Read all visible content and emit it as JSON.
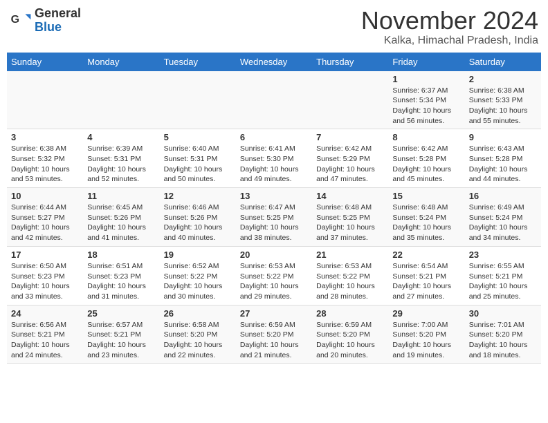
{
  "header": {
    "logo_general": "General",
    "logo_blue": "Blue",
    "month_title": "November 2024",
    "location": "Kalka, Himachal Pradesh, India"
  },
  "calendar": {
    "days_of_week": [
      "Sunday",
      "Monday",
      "Tuesday",
      "Wednesday",
      "Thursday",
      "Friday",
      "Saturday"
    ],
    "weeks": [
      [
        {
          "day": "",
          "detail": ""
        },
        {
          "day": "",
          "detail": ""
        },
        {
          "day": "",
          "detail": ""
        },
        {
          "day": "",
          "detail": ""
        },
        {
          "day": "",
          "detail": ""
        },
        {
          "day": "1",
          "detail": "Sunrise: 6:37 AM\nSunset: 5:34 PM\nDaylight: 10 hours and 56 minutes."
        },
        {
          "day": "2",
          "detail": "Sunrise: 6:38 AM\nSunset: 5:33 PM\nDaylight: 10 hours and 55 minutes."
        }
      ],
      [
        {
          "day": "3",
          "detail": "Sunrise: 6:38 AM\nSunset: 5:32 PM\nDaylight: 10 hours and 53 minutes."
        },
        {
          "day": "4",
          "detail": "Sunrise: 6:39 AM\nSunset: 5:31 PM\nDaylight: 10 hours and 52 minutes."
        },
        {
          "day": "5",
          "detail": "Sunrise: 6:40 AM\nSunset: 5:31 PM\nDaylight: 10 hours and 50 minutes."
        },
        {
          "day": "6",
          "detail": "Sunrise: 6:41 AM\nSunset: 5:30 PM\nDaylight: 10 hours and 49 minutes."
        },
        {
          "day": "7",
          "detail": "Sunrise: 6:42 AM\nSunset: 5:29 PM\nDaylight: 10 hours and 47 minutes."
        },
        {
          "day": "8",
          "detail": "Sunrise: 6:42 AM\nSunset: 5:28 PM\nDaylight: 10 hours and 45 minutes."
        },
        {
          "day": "9",
          "detail": "Sunrise: 6:43 AM\nSunset: 5:28 PM\nDaylight: 10 hours and 44 minutes."
        }
      ],
      [
        {
          "day": "10",
          "detail": "Sunrise: 6:44 AM\nSunset: 5:27 PM\nDaylight: 10 hours and 42 minutes."
        },
        {
          "day": "11",
          "detail": "Sunrise: 6:45 AM\nSunset: 5:26 PM\nDaylight: 10 hours and 41 minutes."
        },
        {
          "day": "12",
          "detail": "Sunrise: 6:46 AM\nSunset: 5:26 PM\nDaylight: 10 hours and 40 minutes."
        },
        {
          "day": "13",
          "detail": "Sunrise: 6:47 AM\nSunset: 5:25 PM\nDaylight: 10 hours and 38 minutes."
        },
        {
          "day": "14",
          "detail": "Sunrise: 6:48 AM\nSunset: 5:25 PM\nDaylight: 10 hours and 37 minutes."
        },
        {
          "day": "15",
          "detail": "Sunrise: 6:48 AM\nSunset: 5:24 PM\nDaylight: 10 hours and 35 minutes."
        },
        {
          "day": "16",
          "detail": "Sunrise: 6:49 AM\nSunset: 5:24 PM\nDaylight: 10 hours and 34 minutes."
        }
      ],
      [
        {
          "day": "17",
          "detail": "Sunrise: 6:50 AM\nSunset: 5:23 PM\nDaylight: 10 hours and 33 minutes."
        },
        {
          "day": "18",
          "detail": "Sunrise: 6:51 AM\nSunset: 5:23 PM\nDaylight: 10 hours and 31 minutes."
        },
        {
          "day": "19",
          "detail": "Sunrise: 6:52 AM\nSunset: 5:22 PM\nDaylight: 10 hours and 30 minutes."
        },
        {
          "day": "20",
          "detail": "Sunrise: 6:53 AM\nSunset: 5:22 PM\nDaylight: 10 hours and 29 minutes."
        },
        {
          "day": "21",
          "detail": "Sunrise: 6:53 AM\nSunset: 5:22 PM\nDaylight: 10 hours and 28 minutes."
        },
        {
          "day": "22",
          "detail": "Sunrise: 6:54 AM\nSunset: 5:21 PM\nDaylight: 10 hours and 27 minutes."
        },
        {
          "day": "23",
          "detail": "Sunrise: 6:55 AM\nSunset: 5:21 PM\nDaylight: 10 hours and 25 minutes."
        }
      ],
      [
        {
          "day": "24",
          "detail": "Sunrise: 6:56 AM\nSunset: 5:21 PM\nDaylight: 10 hours and 24 minutes."
        },
        {
          "day": "25",
          "detail": "Sunrise: 6:57 AM\nSunset: 5:21 PM\nDaylight: 10 hours and 23 minutes."
        },
        {
          "day": "26",
          "detail": "Sunrise: 6:58 AM\nSunset: 5:20 PM\nDaylight: 10 hours and 22 minutes."
        },
        {
          "day": "27",
          "detail": "Sunrise: 6:59 AM\nSunset: 5:20 PM\nDaylight: 10 hours and 21 minutes."
        },
        {
          "day": "28",
          "detail": "Sunrise: 6:59 AM\nSunset: 5:20 PM\nDaylight: 10 hours and 20 minutes."
        },
        {
          "day": "29",
          "detail": "Sunrise: 7:00 AM\nSunset: 5:20 PM\nDaylight: 10 hours and 19 minutes."
        },
        {
          "day": "30",
          "detail": "Sunrise: 7:01 AM\nSunset: 5:20 PM\nDaylight: 10 hours and 18 minutes."
        }
      ]
    ]
  }
}
